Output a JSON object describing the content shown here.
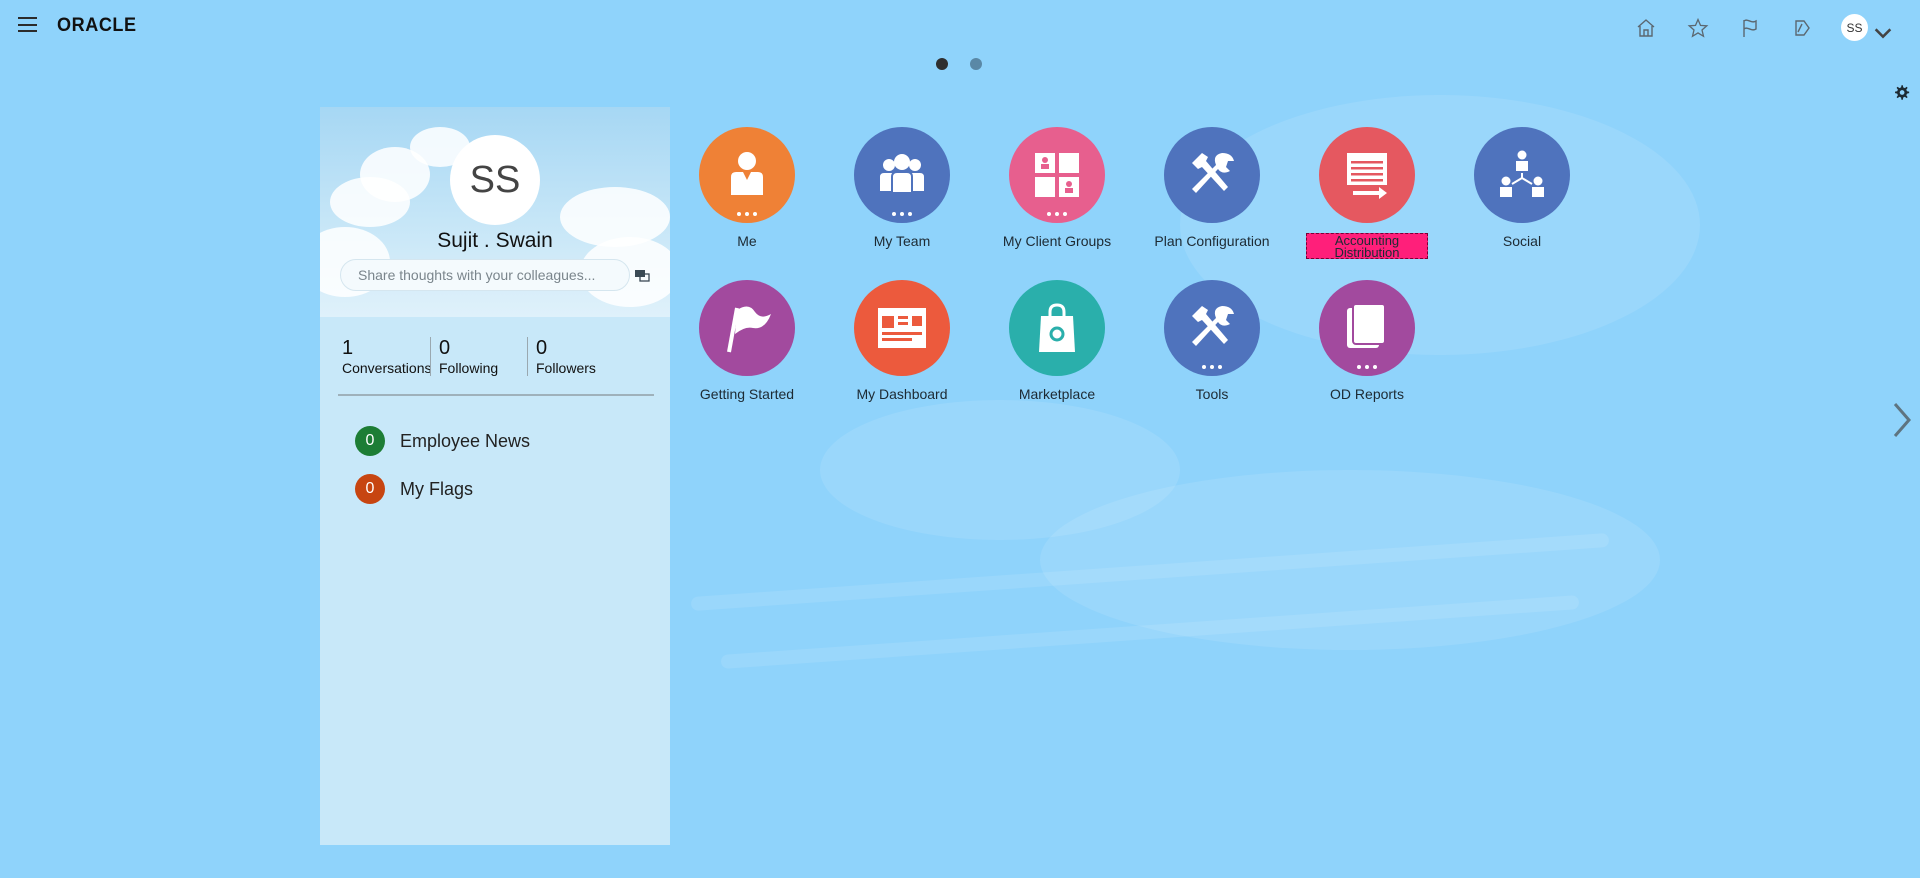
{
  "header": {
    "logo": "ORACLE",
    "avatar_initials": "SS",
    "icons": [
      "home-icon",
      "star-icon",
      "flag-icon",
      "notification-icon"
    ]
  },
  "pager": {
    "pages": 2,
    "active": 1
  },
  "profile": {
    "initials": "SS",
    "name": "Sujit . Swain",
    "share_placeholder": "Share thoughts with your colleagues...",
    "stats": [
      {
        "num": "1",
        "label": "Conversations"
      },
      {
        "num": "0",
        "label": "Following"
      },
      {
        "num": "0",
        "label": "Followers"
      }
    ],
    "items": [
      {
        "count": "0",
        "label": "Employee News",
        "color": "#1d7d35"
      },
      {
        "count": "0",
        "label": "My Flags",
        "color": "#c74511"
      }
    ]
  },
  "tiles": [
    {
      "label": "Me",
      "color": "#ef8136",
      "icon": "person-icon",
      "more": true
    },
    {
      "label": "My Team",
      "color": "#4f73bd",
      "icon": "team-icon",
      "more": true
    },
    {
      "label": "My Client Groups",
      "color": "#e75f8e",
      "icon": "client-groups-icon",
      "more": true
    },
    {
      "label": "Plan Configuration",
      "color": "#4f73bd",
      "icon": "tools-icon",
      "more": false
    },
    {
      "label": "Accounting Distribution",
      "color": "#e55860",
      "icon": "accounting-icon",
      "more": false,
      "highlight": true
    },
    {
      "label": "Social",
      "color": "#4f73bd",
      "icon": "social-icon",
      "more": false
    },
    {
      "label": "Getting Started",
      "color": "#a24a9e",
      "icon": "flag-icon",
      "more": false
    },
    {
      "label": "My Dashboard",
      "color": "#ec5a3d",
      "icon": "dashboard-icon",
      "more": false
    },
    {
      "label": "Marketplace",
      "color": "#2aafab",
      "icon": "bag-icon",
      "more": false
    },
    {
      "label": "Tools",
      "color": "#4f73bd",
      "icon": "tools-icon",
      "more": true
    },
    {
      "label": "OD Reports",
      "color": "#a24a9e",
      "icon": "reports-icon",
      "more": true
    }
  ]
}
